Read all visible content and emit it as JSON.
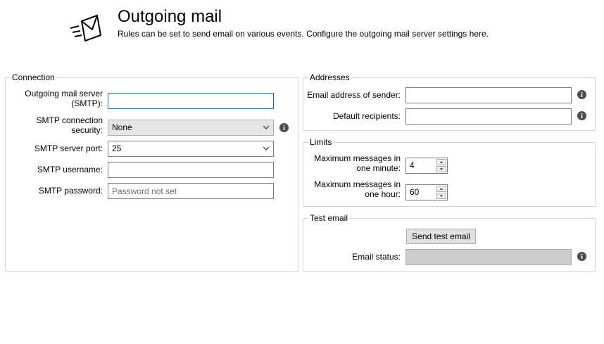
{
  "header": {
    "icon": "envelope-sending-icon",
    "title": "Outgoing mail",
    "subtitle": "Rules can be set to send email on various events. Configure the outgoing mail server settings here."
  },
  "connection": {
    "legend": "Connection",
    "server_label_line1": "Outgoing mail server",
    "server_label_line2": "(SMTP):",
    "server_value": "",
    "security_label_line1": "SMTP connection",
    "security_label_line2": "security:",
    "security_value": "None",
    "port_label": "SMTP server port:",
    "port_value": "25",
    "username_label": "SMTP username:",
    "username_value": "",
    "password_label": "SMTP password:",
    "password_placeholder": "Password not set"
  },
  "addresses": {
    "legend": "Addresses",
    "sender_label": "Email address of sender:",
    "sender_value": "",
    "recipients_label": "Default recipients:",
    "recipients_value": ""
  },
  "limits": {
    "legend": "Limits",
    "per_minute_label_line1": "Maximum messages in",
    "per_minute_label_line2": "one minute:",
    "per_minute_value": "4",
    "per_hour_label_line1": "Maximum messages in",
    "per_hour_label_line2": "one hour:",
    "per_hour_value": "60"
  },
  "test_email": {
    "legend": "Test email",
    "send_button": "Send test email",
    "status_label": "Email status:",
    "status_value": ""
  },
  "colors": {
    "focus_border": "#0078d7",
    "info_icon": "#4d4d4d",
    "status_fill": "#cccccc"
  }
}
